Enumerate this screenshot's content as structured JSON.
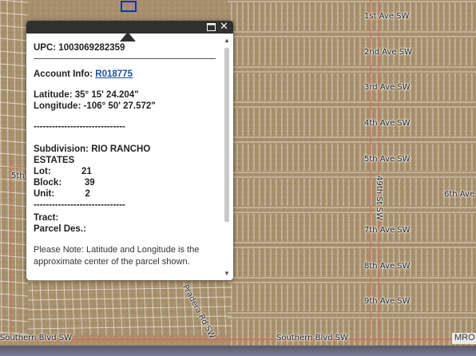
{
  "map": {
    "streets": [
      {
        "name": "1st Ave SW"
      },
      {
        "name": "2nd Ave SW"
      },
      {
        "name": "3rd Ave SW"
      },
      {
        "name": "4th Ave SW"
      },
      {
        "name": "5th Ave SW"
      },
      {
        "name": "6th Ave"
      },
      {
        "name": "7th Ave SW"
      },
      {
        "name": "8th Ave SW"
      },
      {
        "name": "9th Ave SW"
      },
      {
        "name": "49th St SW"
      },
      {
        "name": "Southern Blvd SW"
      },
      {
        "name": "Southern Blvd SW"
      },
      {
        "name": "5th"
      },
      {
        "name": "Pradera Rd SW"
      }
    ],
    "corner_label": "MRO",
    "colors": {
      "imagery": "#a8916f",
      "parcel_lines": "#f2ece2",
      "selection": "#1a25e6",
      "roads": "#d9685a"
    }
  },
  "popup": {
    "header_buttons": {
      "maximize_icon": "maximize-icon",
      "close_icon": "close-icon",
      "close_glyph": "✕"
    },
    "upc": "UPC: 1003069282359",
    "account_label": "Account Info: ",
    "account_link": "R018775",
    "latitude": "Latitude: 35° 15' 24.204\"",
    "longitude": "Longitude: -106° 50' 27.572\"",
    "separator": "------------------------------",
    "subdivision_line1": "Subdivision: RIO RANCHO",
    "subdivision_line2": "ESTATES",
    "lot": "Lot:            21",
    "block": "Block:         39",
    "unit": "Unit:            2",
    "tract": "Tract:",
    "parcel_des": "Parcel Des.:",
    "note": "Please Note: Latitude and Longitude is the approximate center of the parcel shown."
  }
}
